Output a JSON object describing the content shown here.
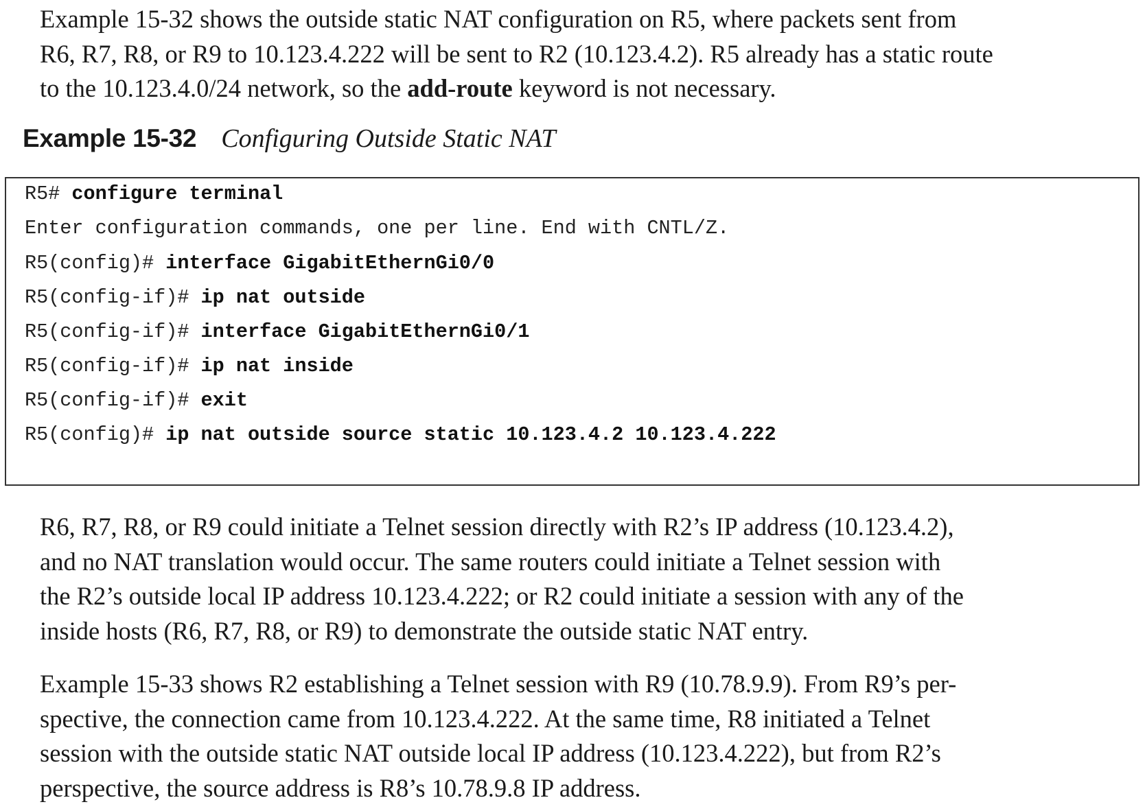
{
  "intro_paragraph": {
    "line1": "Example 15-32 shows the outside static NAT configuration on R5, where packets sent from",
    "line2": "R6, R7, R8, or R9 to 10.123.4.222 will be sent to R2 (10.123.4.2). R5 already has a static route",
    "line3_before": "to the 10.123.4.0/24 network, so the ",
    "line3_bold": "add-route",
    "line3_after": " keyword is not necessary."
  },
  "example_caption": {
    "label": "Example 15-32",
    "title": "Configuring Outside Static NAT"
  },
  "code_lines": [
    {
      "prompt": "R5# ",
      "command": "configure terminal"
    },
    {
      "prompt": "Enter configuration commands, one per line. End with CNTL/Z.",
      "command": ""
    },
    {
      "prompt": "R5(config)# ",
      "command": "interface GigabitEthernGi0/0"
    },
    {
      "prompt": "R5(config-if)# ",
      "command": "ip nat outside"
    },
    {
      "prompt": "R5(config-if)# ",
      "command": "interface GigabitEthernGi0/1"
    },
    {
      "prompt": "R5(config-if)# ",
      "command": "ip nat inside"
    },
    {
      "prompt": "R5(config-if)# ",
      "command": "exit"
    },
    {
      "prompt": "R5(config)# ",
      "command": "ip nat outside source static 10.123.4.2 10.123.4.222"
    }
  ],
  "paragraph2": [
    "R6, R7, R8, or R9 could initiate a Telnet session directly with R2’s IP address (10.123.4.2),",
    "and no NAT translation would occur. The same routers could initiate a Telnet session with",
    "the R2’s outside local IP address 10.123.4.222; or R2 could initiate a session with any of the",
    "inside hosts (R6, R7, R8, or R9) to demonstrate the outside static NAT entry."
  ],
  "paragraph3": [
    "Example 15-33 shows R2 establishing a Telnet session with R9 (10.78.9.9). From R9’s per-",
    "spective, the connection came from 10.123.4.222. At the same time, R8 initiated a Telnet",
    "session with the outside static NAT outside local IP address (10.123.4.222), but from R2’s",
    "perspective, the source address is R8’s 10.78.9.8 IP address."
  ]
}
